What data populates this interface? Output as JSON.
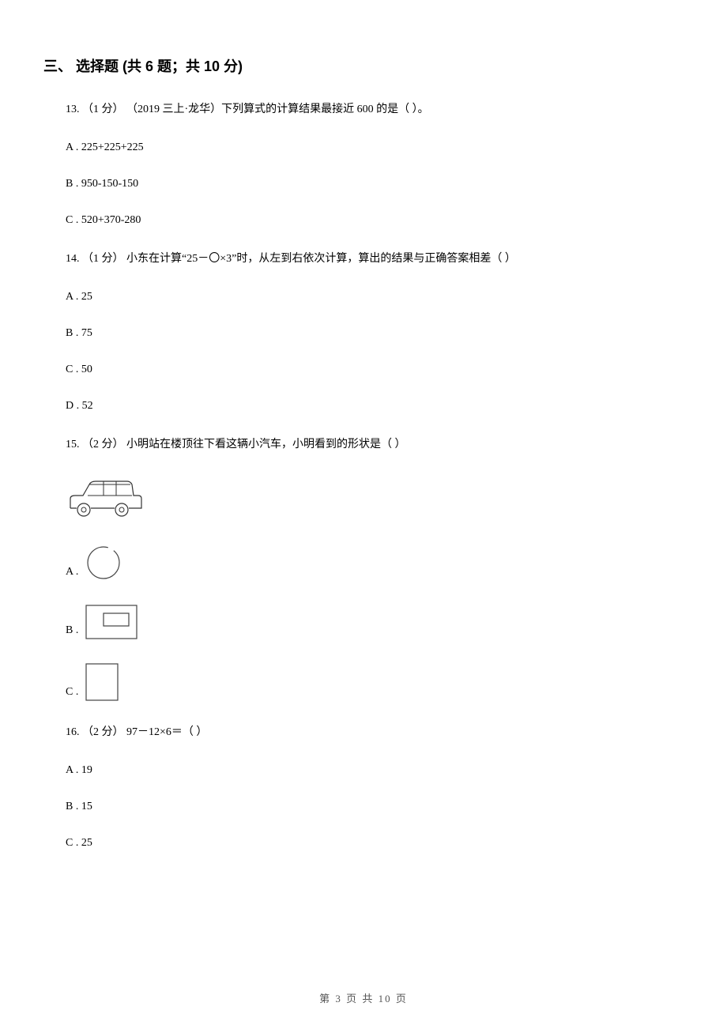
{
  "section_title": "三、 选择题 (共 6 题；共 10 分)",
  "q13": {
    "text": "13. （1 分） （2019 三上·龙华）下列算式的计算结果最接近 600 的是（   ）。",
    "a": "A . 225+225+225",
    "b": "B . 950-150-150",
    "c": "C . 520+370-280"
  },
  "q14": {
    "text": "14. （1 分） 小东在计算“25－〇×3”时，从左到右依次计算，算出的结果与正确答案相差（   ）",
    "a": "A . 25",
    "b": "B . 75",
    "c": "C . 50",
    "d": "D . 52"
  },
  "q15": {
    "text": "15. （2 分） 小明站在楼顶往下看这辆小汽车，小明看到的形状是（   ）",
    "a": "A .",
    "b": "B .",
    "c": "C ."
  },
  "q16": {
    "text": "16. （2 分） 97－12×6＝（   ）",
    "a": "A . 19",
    "b": "B . 15",
    "c": "C . 25"
  },
  "footer": "第 3 页 共 10 页"
}
